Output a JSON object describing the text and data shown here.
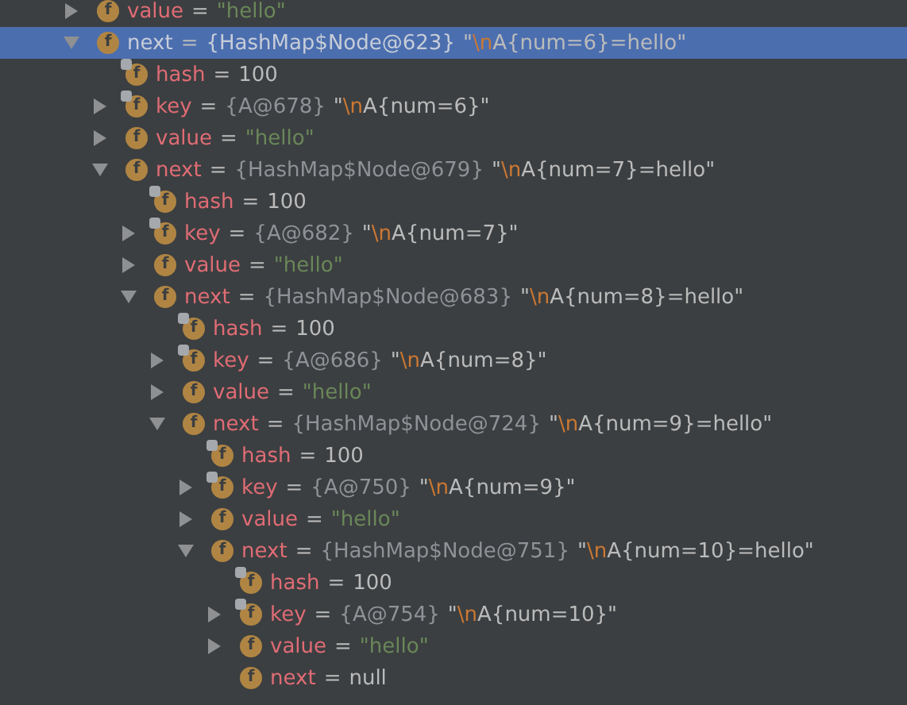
{
  "tree": [
    {
      "icon": "f",
      "final": false,
      "expanded": false,
      "selected": false,
      "label": [
        {
          "kind": "name",
          "text": "value"
        },
        {
          "kind": "op",
          "text": "="
        },
        {
          "kind": "string",
          "text": "\"hello\""
        }
      ]
    },
    {
      "icon": "f",
      "final": false,
      "expanded": true,
      "selected": true,
      "label": [
        {
          "kind": "name",
          "text": "next"
        },
        {
          "kind": "op",
          "text": "="
        },
        {
          "kind": "ref",
          "text": "{HashMap$Node@623}"
        },
        {
          "kind": "text",
          "text": "\""
        },
        {
          "kind": "escape",
          "text": "\\n"
        },
        {
          "kind": "text",
          "text": "A{num=6}=hello\""
        }
      ],
      "children": [
        {
          "icon": "f",
          "final": true,
          "selected": false,
          "label": [
            {
              "kind": "name",
              "text": "hash"
            },
            {
              "kind": "op",
              "text": "="
            },
            {
              "kind": "text",
              "text": "100"
            }
          ]
        },
        {
          "icon": "f",
          "final": true,
          "expanded": false,
          "selected": false,
          "label": [
            {
              "kind": "name",
              "text": "key"
            },
            {
              "kind": "op",
              "text": "="
            },
            {
              "kind": "ref",
              "text": "{A@678}"
            },
            {
              "kind": "text",
              "text": "\""
            },
            {
              "kind": "escape",
              "text": "\\n"
            },
            {
              "kind": "text",
              "text": "A{num=6}\""
            }
          ]
        },
        {
          "icon": "f",
          "final": false,
          "expanded": false,
          "selected": false,
          "label": [
            {
              "kind": "name",
              "text": "value"
            },
            {
              "kind": "op",
              "text": "="
            },
            {
              "kind": "string",
              "text": "\"hello\""
            }
          ]
        },
        {
          "icon": "f",
          "final": false,
          "expanded": true,
          "selected": false,
          "label": [
            {
              "kind": "name",
              "text": "next"
            },
            {
              "kind": "op",
              "text": "="
            },
            {
              "kind": "ref",
              "text": "{HashMap$Node@679}"
            },
            {
              "kind": "text",
              "text": "\""
            },
            {
              "kind": "escape",
              "text": "\\n"
            },
            {
              "kind": "text",
              "text": "A{num=7}=hello\""
            }
          ],
          "children": [
            {
              "icon": "f",
              "final": true,
              "selected": false,
              "label": [
                {
                  "kind": "name",
                  "text": "hash"
                },
                {
                  "kind": "op",
                  "text": "="
                },
                {
                  "kind": "text",
                  "text": "100"
                }
              ]
            },
            {
              "icon": "f",
              "final": true,
              "expanded": false,
              "selected": false,
              "label": [
                {
                  "kind": "name",
                  "text": "key"
                },
                {
                  "kind": "op",
                  "text": "="
                },
                {
                  "kind": "ref",
                  "text": "{A@682}"
                },
                {
                  "kind": "text",
                  "text": "\""
                },
                {
                  "kind": "escape",
                  "text": "\\n"
                },
                {
                  "kind": "text",
                  "text": "A{num=7}\""
                }
              ]
            },
            {
              "icon": "f",
              "final": false,
              "expanded": false,
              "selected": false,
              "label": [
                {
                  "kind": "name",
                  "text": "value"
                },
                {
                  "kind": "op",
                  "text": "="
                },
                {
                  "kind": "string",
                  "text": "\"hello\""
                }
              ]
            },
            {
              "icon": "f",
              "final": false,
              "expanded": true,
              "selected": false,
              "label": [
                {
                  "kind": "name",
                  "text": "next"
                },
                {
                  "kind": "op",
                  "text": "="
                },
                {
                  "kind": "ref",
                  "text": "{HashMap$Node@683}"
                },
                {
                  "kind": "text",
                  "text": "\""
                },
                {
                  "kind": "escape",
                  "text": "\\n"
                },
                {
                  "kind": "text",
                  "text": "A{num=8}=hello\""
                }
              ],
              "children": [
                {
                  "icon": "f",
                  "final": true,
                  "selected": false,
                  "label": [
                    {
                      "kind": "name",
                      "text": "hash"
                    },
                    {
                      "kind": "op",
                      "text": "="
                    },
                    {
                      "kind": "text",
                      "text": "100"
                    }
                  ]
                },
                {
                  "icon": "f",
                  "final": true,
                  "expanded": false,
                  "selected": false,
                  "label": [
                    {
                      "kind": "name",
                      "text": "key"
                    },
                    {
                      "kind": "op",
                      "text": "="
                    },
                    {
                      "kind": "ref",
                      "text": "{A@686}"
                    },
                    {
                      "kind": "text",
                      "text": "\""
                    },
                    {
                      "kind": "escape",
                      "text": "\\n"
                    },
                    {
                      "kind": "text",
                      "text": "A{num=8}\""
                    }
                  ]
                },
                {
                  "icon": "f",
                  "final": false,
                  "expanded": false,
                  "selected": false,
                  "label": [
                    {
                      "kind": "name",
                      "text": "value"
                    },
                    {
                      "kind": "op",
                      "text": "="
                    },
                    {
                      "kind": "string",
                      "text": "\"hello\""
                    }
                  ]
                },
                {
                  "icon": "f",
                  "final": false,
                  "expanded": true,
                  "selected": false,
                  "label": [
                    {
                      "kind": "name",
                      "text": "next"
                    },
                    {
                      "kind": "op",
                      "text": "="
                    },
                    {
                      "kind": "ref",
                      "text": "{HashMap$Node@724}"
                    },
                    {
                      "kind": "text",
                      "text": "\""
                    },
                    {
                      "kind": "escape",
                      "text": "\\n"
                    },
                    {
                      "kind": "text",
                      "text": "A{num=9}=hello\""
                    }
                  ],
                  "children": [
                    {
                      "icon": "f",
                      "final": true,
                      "selected": false,
                      "label": [
                        {
                          "kind": "name",
                          "text": "hash"
                        },
                        {
                          "kind": "op",
                          "text": "="
                        },
                        {
                          "kind": "text",
                          "text": "100"
                        }
                      ]
                    },
                    {
                      "icon": "f",
                      "final": true,
                      "expanded": false,
                      "selected": false,
                      "label": [
                        {
                          "kind": "name",
                          "text": "key"
                        },
                        {
                          "kind": "op",
                          "text": "="
                        },
                        {
                          "kind": "ref",
                          "text": "{A@750}"
                        },
                        {
                          "kind": "text",
                          "text": "\""
                        },
                        {
                          "kind": "escape",
                          "text": "\\n"
                        },
                        {
                          "kind": "text",
                          "text": "A{num=9}\""
                        }
                      ]
                    },
                    {
                      "icon": "f",
                      "final": false,
                      "expanded": false,
                      "selected": false,
                      "label": [
                        {
                          "kind": "name",
                          "text": "value"
                        },
                        {
                          "kind": "op",
                          "text": "="
                        },
                        {
                          "kind": "string",
                          "text": "\"hello\""
                        }
                      ]
                    },
                    {
                      "icon": "f",
                      "final": false,
                      "expanded": true,
                      "selected": false,
                      "label": [
                        {
                          "kind": "name",
                          "text": "next"
                        },
                        {
                          "kind": "op",
                          "text": "="
                        },
                        {
                          "kind": "ref",
                          "text": "{HashMap$Node@751}"
                        },
                        {
                          "kind": "text",
                          "text": "\""
                        },
                        {
                          "kind": "escape",
                          "text": "\\n"
                        },
                        {
                          "kind": "text",
                          "text": "A{num=10}=hello\""
                        }
                      ],
                      "children": [
                        {
                          "icon": "f",
                          "final": true,
                          "selected": false,
                          "label": [
                            {
                              "kind": "name",
                              "text": "hash"
                            },
                            {
                              "kind": "op",
                              "text": "="
                            },
                            {
                              "kind": "text",
                              "text": "100"
                            }
                          ]
                        },
                        {
                          "icon": "f",
                          "final": true,
                          "expanded": false,
                          "selected": false,
                          "label": [
                            {
                              "kind": "name",
                              "text": "key"
                            },
                            {
                              "kind": "op",
                              "text": "="
                            },
                            {
                              "kind": "ref",
                              "text": "{A@754}"
                            },
                            {
                              "kind": "text",
                              "text": "\""
                            },
                            {
                              "kind": "escape",
                              "text": "\\n"
                            },
                            {
                              "kind": "text",
                              "text": "A{num=10}\""
                            }
                          ]
                        },
                        {
                          "icon": "f",
                          "final": false,
                          "expanded": false,
                          "selected": false,
                          "label": [
                            {
                              "kind": "name",
                              "text": "value"
                            },
                            {
                              "kind": "op",
                              "text": "="
                            },
                            {
                              "kind": "string",
                              "text": "\"hello\""
                            }
                          ]
                        },
                        {
                          "icon": "f",
                          "final": false,
                          "selected": false,
                          "label": [
                            {
                              "kind": "name",
                              "text": "next"
                            },
                            {
                              "kind": "op",
                              "text": "="
                            },
                            {
                              "kind": "text",
                              "text": "null"
                            }
                          ]
                        }
                      ]
                    }
                  ]
                }
              ]
            }
          ]
        }
      ]
    }
  ]
}
